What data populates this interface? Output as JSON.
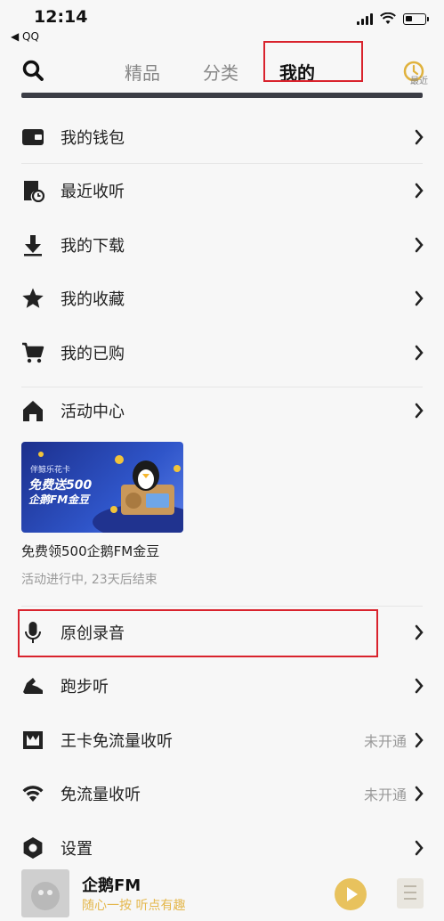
{
  "status": {
    "time": "12:14",
    "back_app": "◀ QQ"
  },
  "nav": {
    "tabs": [
      {
        "label": "精品"
      },
      {
        "label": "分类"
      },
      {
        "label": "我的"
      }
    ],
    "recent_label": "最近",
    "active_tab": "我的",
    "accent": "#d9232d"
  },
  "menu": {
    "wallet": "我的钱包",
    "recent_listen": "最近收听",
    "downloads": "我的下载",
    "favorites": "我的收藏",
    "purchased": "我的已购",
    "activity_center": "活动中心",
    "original_recording": "原创录音",
    "running": "跑步听",
    "wangka": "王卡免流量收听",
    "wangka_status": "未开通",
    "free_data": "免流量收听",
    "free_data_status": "未开通",
    "settings": "设置"
  },
  "promo": {
    "banner_line1": "伴鲸乐花卡",
    "banner_line2": "免费送500",
    "banner_line3": "企鹅FM金豆",
    "title": "免费领500企鹅FM金豆",
    "subtitle": "活动进行中, 23天后结束"
  },
  "player": {
    "title": "企鹅FM",
    "subtitle": "随心一按 听点有趣"
  }
}
